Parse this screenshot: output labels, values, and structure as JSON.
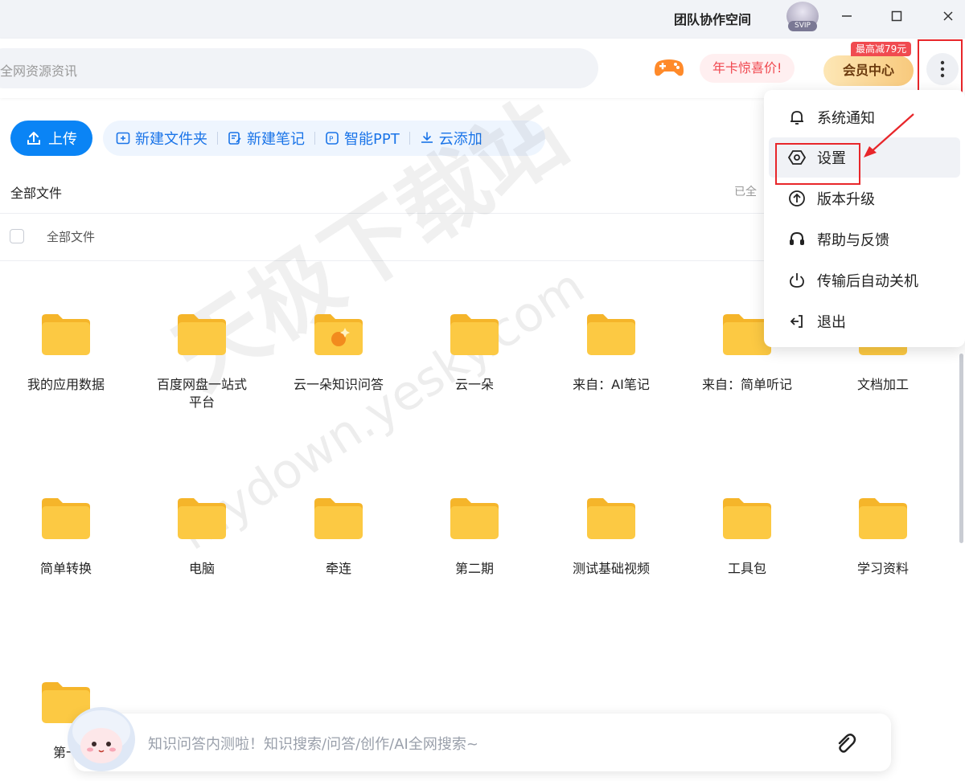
{
  "titlebar": {
    "team_space": "团队协作空间",
    "svip": "SVIP"
  },
  "toolbar": {
    "search_placeholder": "全网资源资讯",
    "year_promo": "年卡惊喜价!",
    "vip_center": "会员中心",
    "vip_tag": "最高减79元"
  },
  "actions": {
    "upload": "上传",
    "new_folder": "新建文件夹",
    "new_note": "新建笔记",
    "smart_ppt": "智能PPT",
    "cloud_add": "云添加"
  },
  "breadcrumb": "全部文件",
  "loaded_hint": "已全",
  "list_header": "全部文件",
  "folders": [
    {
      "name": "我的应用数据"
    },
    {
      "name": "百度网盘一站式平台"
    },
    {
      "name": "云一朵知识问答"
    },
    {
      "name": "云一朵"
    },
    {
      "name": "来自：AI笔记"
    },
    {
      "name": "来自：简单听记"
    },
    {
      "name": "文档加工"
    },
    {
      "name": "简单转换"
    },
    {
      "name": "电脑"
    },
    {
      "name": "牵连"
    },
    {
      "name": "第二期"
    },
    {
      "name": "测试基础视频"
    },
    {
      "name": "工具包"
    },
    {
      "name": "学习资料"
    },
    {
      "name": "第一"
    }
  ],
  "menu": {
    "items": [
      {
        "label": "系统通知",
        "icon": "bell-icon"
      },
      {
        "label": "设置",
        "icon": "settings-hexagon-icon"
      },
      {
        "label": "版本升级",
        "icon": "upgrade-icon"
      },
      {
        "label": "帮助与反馈",
        "icon": "headset-icon"
      },
      {
        "label": "传输后自动关机",
        "icon": "power-icon"
      },
      {
        "label": "退出",
        "icon": "logout-icon"
      }
    ]
  },
  "ai_bar": {
    "placeholder": "知识问答内测啦！知识搜索/问答/创作/AI全网搜索~"
  },
  "watermark": {
    "main": "天极下载站",
    "sub": "mydown.yesky.com"
  },
  "colors": {
    "accent": "#0a84f5",
    "folder": "#fcc943",
    "annotation": "#e8262a"
  }
}
